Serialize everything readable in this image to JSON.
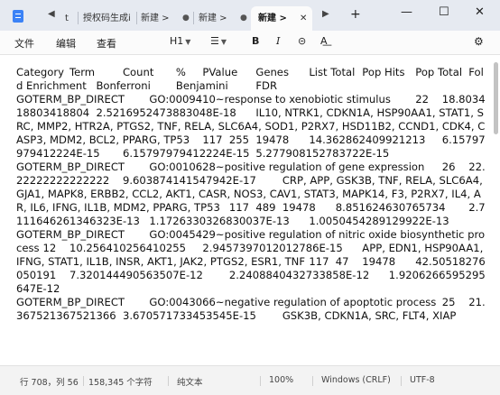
{
  "titlebar": {
    "tabs": [
      {
        "label": "t"
      },
      {
        "label": "授权码生成i"
      },
      {
        "label": "新建 >"
      },
      {
        "label": "新建 >"
      },
      {
        "label": "新建 >"
      }
    ],
    "dot": "●",
    "close": "✕",
    "new_tab": "+",
    "prev": "◀",
    "next": "▶",
    "minimize": "—",
    "maximize": "☐",
    "close_window": "✕"
  },
  "menu": {
    "file": "文件",
    "edit": "编辑",
    "view": "查看"
  },
  "format": {
    "heading": "H1",
    "list": "☰",
    "bold": "B",
    "italic": "I",
    "link": "⊝",
    "clear": "A͟",
    "settings": "⚙"
  },
  "document": {
    "text": "Category\tTerm\tCount\t%\tPValue\tGenes\tList Total\tPop Hits\tPop Total\tFold Enrichment\tBonferroni\tBenjamini\tFDR\nGOTERM_BP_DIRECT\tGO:0009410~response to xenobiotic stimulus\t22\t18.803418803418804\t2.5216952473883048E-18\tIL10, NTRK1, CDKN1A, HSP90AA1, STAT1, SRC, MMP2, HTR2A, PTGS2, TNF, RELA, SLC6A4, SOD1, P2RX7, HSD11B2, CCND1, CDK4, CASP3, MDM2, BCL2, PPARG, TP53\t117\t255\t19478\t14.362862409921213\t6.15797979412224E-15\t6.15797979412224E-15\t5.277908152783722E-15\nGOTERM_BP_DIRECT\tGO:0010628~positive regulation of gene expression\t26\t22.22222222222222\t9.603874141547942E-17\tCRP, APP, GSK3B, TNF, RELA, SLC6A4, GJA1, MAPK8, ERBB2, CCL2, AKT1, CASR, NOS3, CAV1, STAT3, MAPK14, F3, P2RX7, IL4, AR, IL6, IFNG, IL1B, MDM2, PPARG, TP53\t117\t489\t19478\t8.851624630765734\t2.7111646261346323E-13\t1.1726330326830037E-13\t1.0050454289129922E-13\nGOTERM_BP_DIRECT\tGO:0045429~positive regulation of nitric oxide biosynthetic process\t12\t10.256410256410255\t2.9457397012012786E-15\tAPP, EDN1, HSP90AA1, IFNG, STAT1, IL1B, INSR, AKT1, JAK2, PTGS2, ESR1, TNF\t117\t47\t19478\t42.50518276050191\t7.320144490563507E-12\t2.2408840432733858E-12\t1.9206266595295647E-12\nGOTERM_BP_DIRECT\tGO:0043066~negative regulation of apoptotic process\t25\t21.367521367521366\t3.670571733453545E-15\tGSK3B, CDKN1A, SRC, FLT4, XIAP"
  },
  "status": {
    "position": "行 708，列 56",
    "chars": "158,345 个字符",
    "format": "纯文本",
    "zoom": "100%",
    "line_ending": "Windows (CRLF)",
    "encoding": "UTF-8"
  }
}
